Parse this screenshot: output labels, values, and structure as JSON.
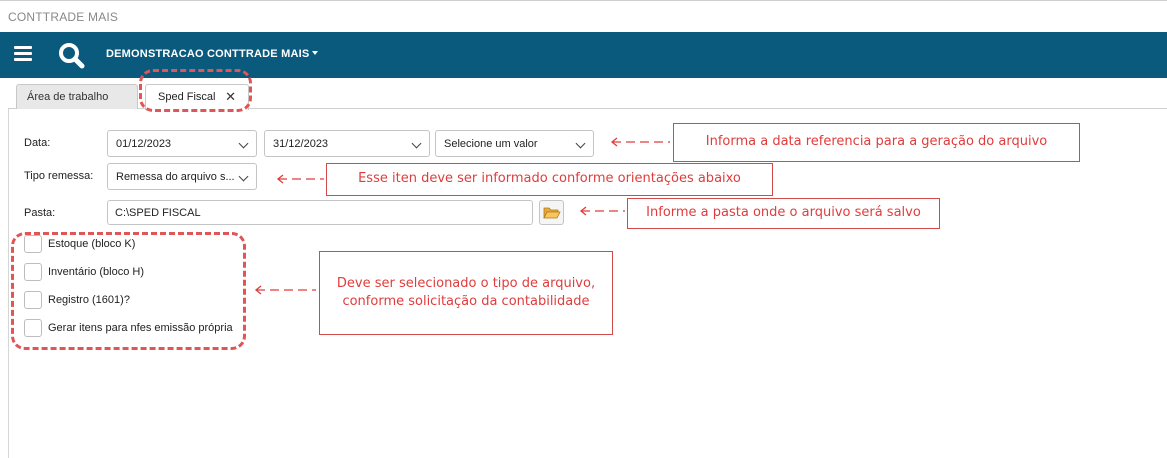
{
  "app": {
    "title": "CONTTRADE MAIS"
  },
  "topbar": {
    "company": "DEMONSTRACAO CONTTRADE MAIS"
  },
  "tabs": [
    {
      "label": "Área de trabalho",
      "active": false
    },
    {
      "label": "Sped Fiscal",
      "active": true,
      "close": "✕"
    }
  ],
  "form": {
    "data_label": "Data:",
    "data_inicio": "01/12/2023",
    "data_fim": "31/12/2023",
    "data_tipo": "Selecione um valor",
    "tipo_remessa_label": "Tipo remessa:",
    "tipo_remessa_value": "Remessa do arquivo s...",
    "pasta_label": "Pasta:",
    "pasta_value": "C:\\SPED FISCAL"
  },
  "checkboxes": [
    {
      "label": "Estoque (bloco K)",
      "checked": false
    },
    {
      "label": "Inventário (bloco H)",
      "checked": false
    },
    {
      "label": "Registro (1601)?",
      "checked": false
    },
    {
      "label": "Gerar itens para nfes emissão própria",
      "checked": false
    }
  ],
  "annotations": {
    "data": "Informa a data referencia para a geração do arquivo",
    "tipo": "Esse iten deve ser informado conforme orientações abaixo",
    "pasta": "Informe a pasta onde o arquivo será salvo",
    "checks_line1": "Deve ser selecionado o tipo de arquivo,",
    "checks_line2": "conforme solicitação da contabilidade"
  },
  "colors": {
    "topbar": "#0a5a7e",
    "annotation": "#e03c3c"
  }
}
